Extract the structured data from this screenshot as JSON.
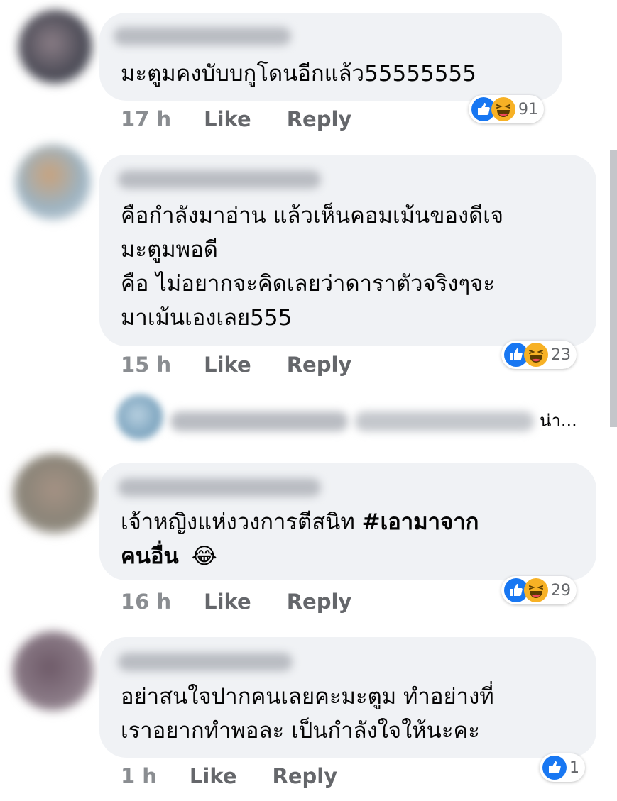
{
  "comments": [
    {
      "text": "มะตูมคงบับบกูโดนอีกแล้ว55555555",
      "time": "17 h",
      "like_label": "Like",
      "reply_label": "Reply",
      "reaction_icons": [
        "like-icon",
        "haha-icon"
      ],
      "reaction_count": "91"
    },
    {
      "text": "คือกำลังมาอ่าน แล้วเห็นคอมเม้นของดีเจ\nมะตูมพอดี\nคือ ไม่อยากจะคิดเลยว่าดาราตัวจริงๆจะ\nมาเม้นเองเลย555",
      "time": "15 h",
      "like_label": "Like",
      "reply_label": "Reply",
      "reaction_icons": [
        "like-icon",
        "haha-icon"
      ],
      "reaction_count": "23",
      "reply_preview_suffix": "น่า..."
    },
    {
      "text_plain": "เจ้าหญิงแห่งวงการตีสนิท ",
      "hashtag_line1": "#เอามาจาก",
      "hashtag_line2": "คนอื่น",
      "emoji": "😂",
      "time": "16 h",
      "like_label": "Like",
      "reply_label": "Reply",
      "reaction_icons": [
        "like-icon",
        "haha-icon"
      ],
      "reaction_count": "29"
    },
    {
      "text": "อย่าสนใจปากคนเลยคะมะตูม ทำอย่างที่\nเราอยากทำพอละ เป็นกำลังใจให้นะคะ",
      "time": "1 h",
      "like_label": "Like",
      "reply_label": "Reply",
      "reaction_icons": [
        "like-icon"
      ],
      "reaction_count": "1"
    }
  ],
  "colors": {
    "bubble": "#f0f2f5",
    "meta_text": "#65676b",
    "like_blue": "#1877f2",
    "haha_yellow": "#f7b125"
  }
}
